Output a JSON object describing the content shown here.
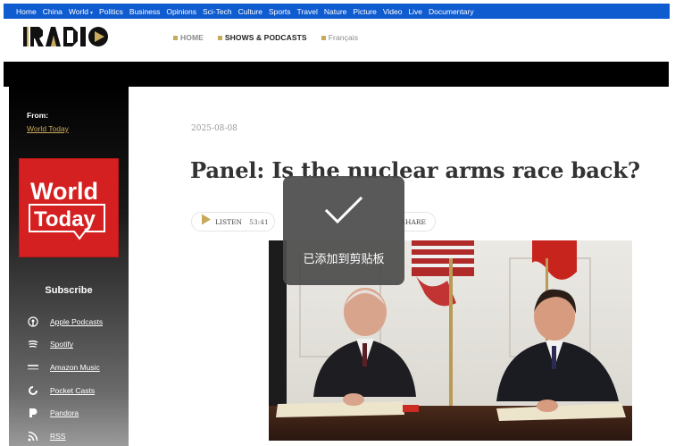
{
  "top_nav": {
    "items": [
      "Home",
      "China",
      "World",
      "Politics",
      "Business",
      "Opinions",
      "Sci-Tech",
      "Culture",
      "Sports",
      "Travel",
      "Nature",
      "Picture",
      "Video",
      "Live",
      "Documentary"
    ],
    "world_caret": "▾"
  },
  "header": {
    "logo_text": "RADIO",
    "nav": [
      {
        "label": "HOME"
      },
      {
        "label": "SHOWS & PODCASTS"
      },
      {
        "label": "Français"
      }
    ],
    "accent_color": "#c9a95b"
  },
  "sidebar": {
    "from_label": "From:",
    "from_link": "World Today",
    "cover_text_line1": "World",
    "cover_text_line2": "Today",
    "subscribe_title": "Subscribe",
    "subscribe_items": [
      {
        "label": "Apple Podcasts",
        "icon": "apple-podcasts-icon"
      },
      {
        "label": "Spotify",
        "icon": "spotify-icon"
      },
      {
        "label": "Amazon Music",
        "icon": "amazon-music-icon"
      },
      {
        "label": "Pocket Casts",
        "icon": "pocket-casts-icon"
      },
      {
        "label": "Pandora",
        "icon": "pandora-icon"
      },
      {
        "label": "RSS",
        "icon": "rss-icon"
      }
    ]
  },
  "article": {
    "date": "2025-08-08",
    "title": "Panel: Is the nuclear arms race back?",
    "listen_label": "LISTEN",
    "duration": "53:41",
    "share_label": "SHARE"
  },
  "toast": {
    "message": "已添加到剪贴板",
    "icon": "check-icon"
  },
  "colors": {
    "top_nav_bg": "#0f5bd0",
    "cover_red": "#d42020"
  }
}
